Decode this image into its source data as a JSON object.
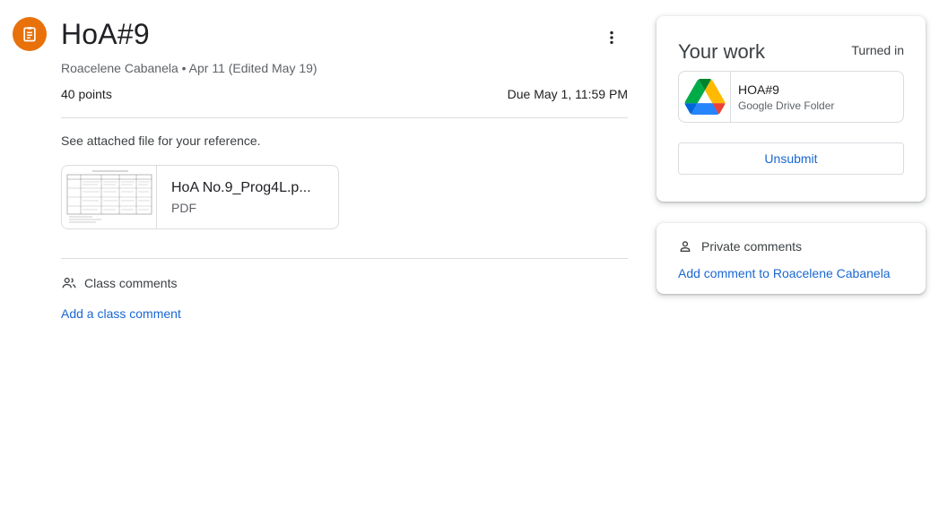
{
  "assignment": {
    "icon": "assignment-icon",
    "title": "HoA#9",
    "meta": "Roacelene Cabanela • Apr 11 (Edited May 19)",
    "points": "40 points",
    "due": "Due May 1, 11:59 PM",
    "instructions": "See attached file for your reference.",
    "attachment": {
      "name": "HoA No.9_Prog4L.p...",
      "type": "PDF"
    }
  },
  "class_comments": {
    "label": "Class comments",
    "add_label": "Add a class comment"
  },
  "your_work": {
    "title": "Your work",
    "status": "Turned in",
    "item": {
      "name": "HOA#9",
      "type": "Google Drive Folder"
    },
    "unsubmit_label": "Unsubmit"
  },
  "private_comments": {
    "label": "Private comments",
    "add_label": "Add comment to Roacelene Cabanela"
  },
  "colors": {
    "accent": "#e8710a",
    "link": "#1967d2",
    "divider": "#dadce0"
  }
}
